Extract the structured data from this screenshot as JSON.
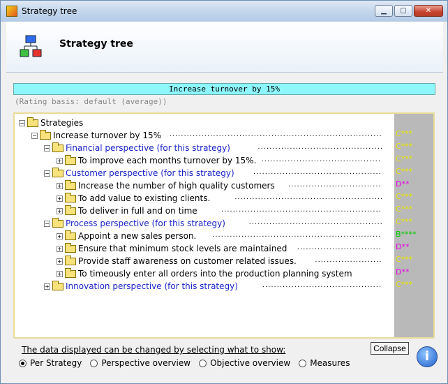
{
  "window": {
    "title": "Strategy tree"
  },
  "header": {
    "title": "Strategy tree"
  },
  "banner": {
    "text": "Increase turnover by 15%"
  },
  "rating_basis": "(Rating basis: default (average))",
  "tree": [
    {
      "label": "Strategies",
      "indent": 0,
      "exp": "-",
      "blue": false,
      "grade": ""
    },
    {
      "label": "Increase turnover by 15%",
      "indent": 1,
      "exp": "-",
      "blue": false,
      "grade": "C***",
      "grade_color": "#e6e600"
    },
    {
      "label": "Financial perspective (for this strategy)",
      "indent": 2,
      "exp": "-",
      "blue": true,
      "grade": "C***",
      "grade_color": "#e6e600"
    },
    {
      "label": "To improve each months turnover by 15%.",
      "indent": 3,
      "exp": "+",
      "blue": false,
      "grade": "C***",
      "grade_color": "#e6e600"
    },
    {
      "label": "Customer perspective (for this strategy)",
      "indent": 2,
      "exp": "-",
      "blue": true,
      "grade": "C***",
      "grade_color": "#e6e600"
    },
    {
      "label": "Increase the number of high quality customers",
      "indent": 3,
      "exp": "+",
      "blue": false,
      "grade": "D**",
      "grade_color": "#e600e6"
    },
    {
      "label": "To add value to existing clients.",
      "indent": 3,
      "exp": "+",
      "blue": false,
      "grade": "C***",
      "grade_color": "#e6e600"
    },
    {
      "label": "To deliver in full and on time",
      "indent": 3,
      "exp": "+",
      "blue": false,
      "grade": "C***",
      "grade_color": "#e6e600"
    },
    {
      "label": "Process perspective (for this strategy)",
      "indent": 2,
      "exp": "-",
      "blue": true,
      "grade": "C***",
      "grade_color": "#e6e600"
    },
    {
      "label": "Appoint a  new sales person.",
      "indent": 3,
      "exp": "+",
      "blue": false,
      "grade": "B****",
      "grade_color": "#00cc00"
    },
    {
      "label": "Ensure that minimum stock levels are maintained",
      "indent": 3,
      "exp": "+",
      "blue": false,
      "grade": "D**",
      "grade_color": "#e600e6"
    },
    {
      "label": "Provide staff awareness on customer related issues.",
      "indent": 3,
      "exp": "+",
      "blue": false,
      "grade": "C***",
      "grade_color": "#e6e600"
    },
    {
      "label": "To timeously enter all orders into the production planning system",
      "indent": 3,
      "exp": "+",
      "blue": false,
      "grade": "D**",
      "grade_color": "#e600e6"
    },
    {
      "label": "Innovation perspective (for this strategy)",
      "indent": 2,
      "exp": "+",
      "blue": true,
      "grade": "C***",
      "grade_color": "#e6e600"
    }
  ],
  "bottom": {
    "prompt": "The data displayed can be changed by selecting what to show:",
    "collapse_label": "Collapse",
    "options": [
      {
        "label": "Per Strategy",
        "selected": true
      },
      {
        "label": "Perspective overview",
        "selected": false
      },
      {
        "label": "Objective overview",
        "selected": false
      },
      {
        "label": "Measures",
        "selected": false
      }
    ],
    "info_glyph": "i"
  }
}
